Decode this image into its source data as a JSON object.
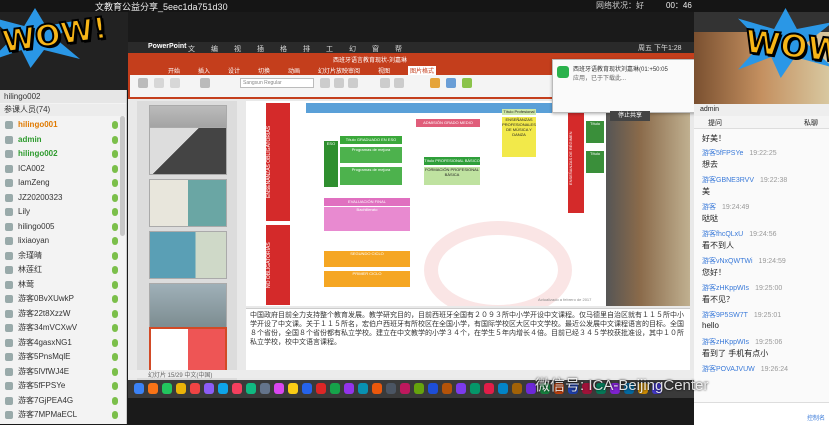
{
  "topbar": {
    "title": "文教育公益分享_5eec1da751d30",
    "net_label": "网络状况：好",
    "timer": "00：46"
  },
  "stickers": {
    "wow_left": "WOW!",
    "wow_right": "WOW!"
  },
  "participants": {
    "header": "hilingo002",
    "subheader": "参课人员(74)",
    "list": [
      {
        "name": "hilingo001",
        "kind": "host"
      },
      {
        "name": "admin",
        "kind": "green"
      },
      {
        "name": "hilingo002",
        "kind": "green"
      },
      {
        "name": "ICA002",
        "kind": "normal"
      },
      {
        "name": "IamZeng",
        "kind": "normal"
      },
      {
        "name": "JZ20200323",
        "kind": "normal"
      },
      {
        "name": "Lily",
        "kind": "normal"
      },
      {
        "name": "hilingo005",
        "kind": "normal"
      },
      {
        "name": "lixiaoyan",
        "kind": "normal"
      },
      {
        "name": "余瑾晴",
        "kind": "normal"
      },
      {
        "name": "林莲红",
        "kind": "normal"
      },
      {
        "name": "林莺",
        "kind": "normal"
      },
      {
        "name": "游客0BvXUwkP",
        "kind": "normal"
      },
      {
        "name": "游客22t8XzzW",
        "kind": "normal"
      },
      {
        "name": "游客34mVCXwV",
        "kind": "normal"
      },
      {
        "name": "游客4gasxNG1",
        "kind": "normal"
      },
      {
        "name": "游客5PnsMqlE",
        "kind": "normal"
      },
      {
        "name": "游客5lVfWJ4E",
        "kind": "normal"
      },
      {
        "name": "游客5fFPSYe",
        "kind": "normal"
      },
      {
        "name": "游客7GjPEA4G",
        "kind": "normal"
      },
      {
        "name": "游客7MPMaECL",
        "kind": "normal"
      }
    ]
  },
  "ppt": {
    "app_name": "PowerPoint",
    "menu": [
      "文件",
      "编辑",
      "视图",
      "插入",
      "格式",
      "排列",
      "工具",
      "幻灯片放映",
      "窗口",
      "帮助"
    ],
    "clock": "周五 下午1:28",
    "doc_title": "西班牙语言教育现状-刘嘉琳",
    "tabs": [
      "开始",
      "插入",
      "设计",
      "切换",
      "动画",
      "幻灯片放映",
      "审阅",
      "视图",
      "图片格式"
    ],
    "active_tab": "图片格式",
    "font_name": "Sangsun Regular",
    "slide_numbers": [
      "11",
      "12",
      "13",
      "14",
      "15"
    ],
    "notes": "中国政府目前全力支持整个教育发展。教学研究目的，目前西班牙全国有２０９３所中小学开设中文课程。仅马德里自治区就有１１５所中小学开设了中文课。关于１１５所名，宏伯户西班牙有所校区在全国小学，有国际学校区大区中文学校。最近公发展中文课程语言的目标。全国８个省份，全国８个省份都有私立学校。建立在中文教学的小学３４个，在学生５年内增长４倍。目前已经３４５学校获批准设，其中１０所私立学校，校中文语言课程。",
    "status": "幻灯片 15/29  中文(中国)",
    "slide": {
      "left_bar_top": "ENSEÑANZAS OBLIGATORIAS",
      "left_bar_bottom": "NO OBLIGATORIAS",
      "top_box": "ADMISIÓN GRADO MEDIO",
      "prof_badge": "Título Profesional",
      "prof_box": "ENSEÑANZAS PROFESIONALES DE MÚSICA Y DANZA",
      "tech_box": "Título PROFESIONAL BÁSICO",
      "formacion": "FORMACIÓN PROFESIONAL BÁSICA",
      "green1": "Título GRADUADO EN ESO",
      "green2": "Programas de mejora",
      "green3": "Programas de mejora",
      "green_label": "ESO",
      "pink_head": "EVALUACIÓN FINAL",
      "pink1": "Bachillerato",
      "orange1": "SEGUNDO CICLO",
      "orange2": "PRIMER CICLO",
      "red_bar": "ENSEÑANZAS DE RÉGIMEN",
      "tag1": "Título",
      "tag2": "Título",
      "footer": "Actualizado a febrero de 2017"
    }
  },
  "notification": {
    "line1": "西班牙语教育现状刘嘉琳(01:+50:05",
    "line2": "应用，已于下载此...",
    "share": "停止共享"
  },
  "watermark": "微信号: ICA-BeijingCenter",
  "chat": {
    "header_user": "admin",
    "tab_left": "提问",
    "tab_right": "私聊",
    "messages": [
      {
        "who": "",
        "time": "",
        "text": "好美！"
      },
      {
        "who": "游客5fFPSYe",
        "time": "19:22:25",
        "text": "想去"
      },
      {
        "who": "游客GBNE3RVV",
        "time": "19:22:38",
        "text": "美"
      },
      {
        "who": "游客",
        "time": "19:24:49",
        "text": "哒哒"
      },
      {
        "who": "游客fhcQLxU",
        "time": "19:24:56",
        "text": "看不到人"
      },
      {
        "who": "游客vNxQWTWi",
        "time": "19:24:59",
        "text": "您好！"
      },
      {
        "who": "游客zHKppWIs",
        "time": "19:25:00",
        "text": "看不见？"
      },
      {
        "who": "游客9P5SW7T",
        "time": "19:25:01",
        "text": "hello"
      },
      {
        "who": "游客zHKppWIs",
        "time": "19:25:06",
        "text": "看到了 手机有点小"
      },
      {
        "who": "游客POVAJVUW",
        "time": "19:26:24",
        "text": ""
      }
    ],
    "input_placeholder": "控制名"
  }
}
